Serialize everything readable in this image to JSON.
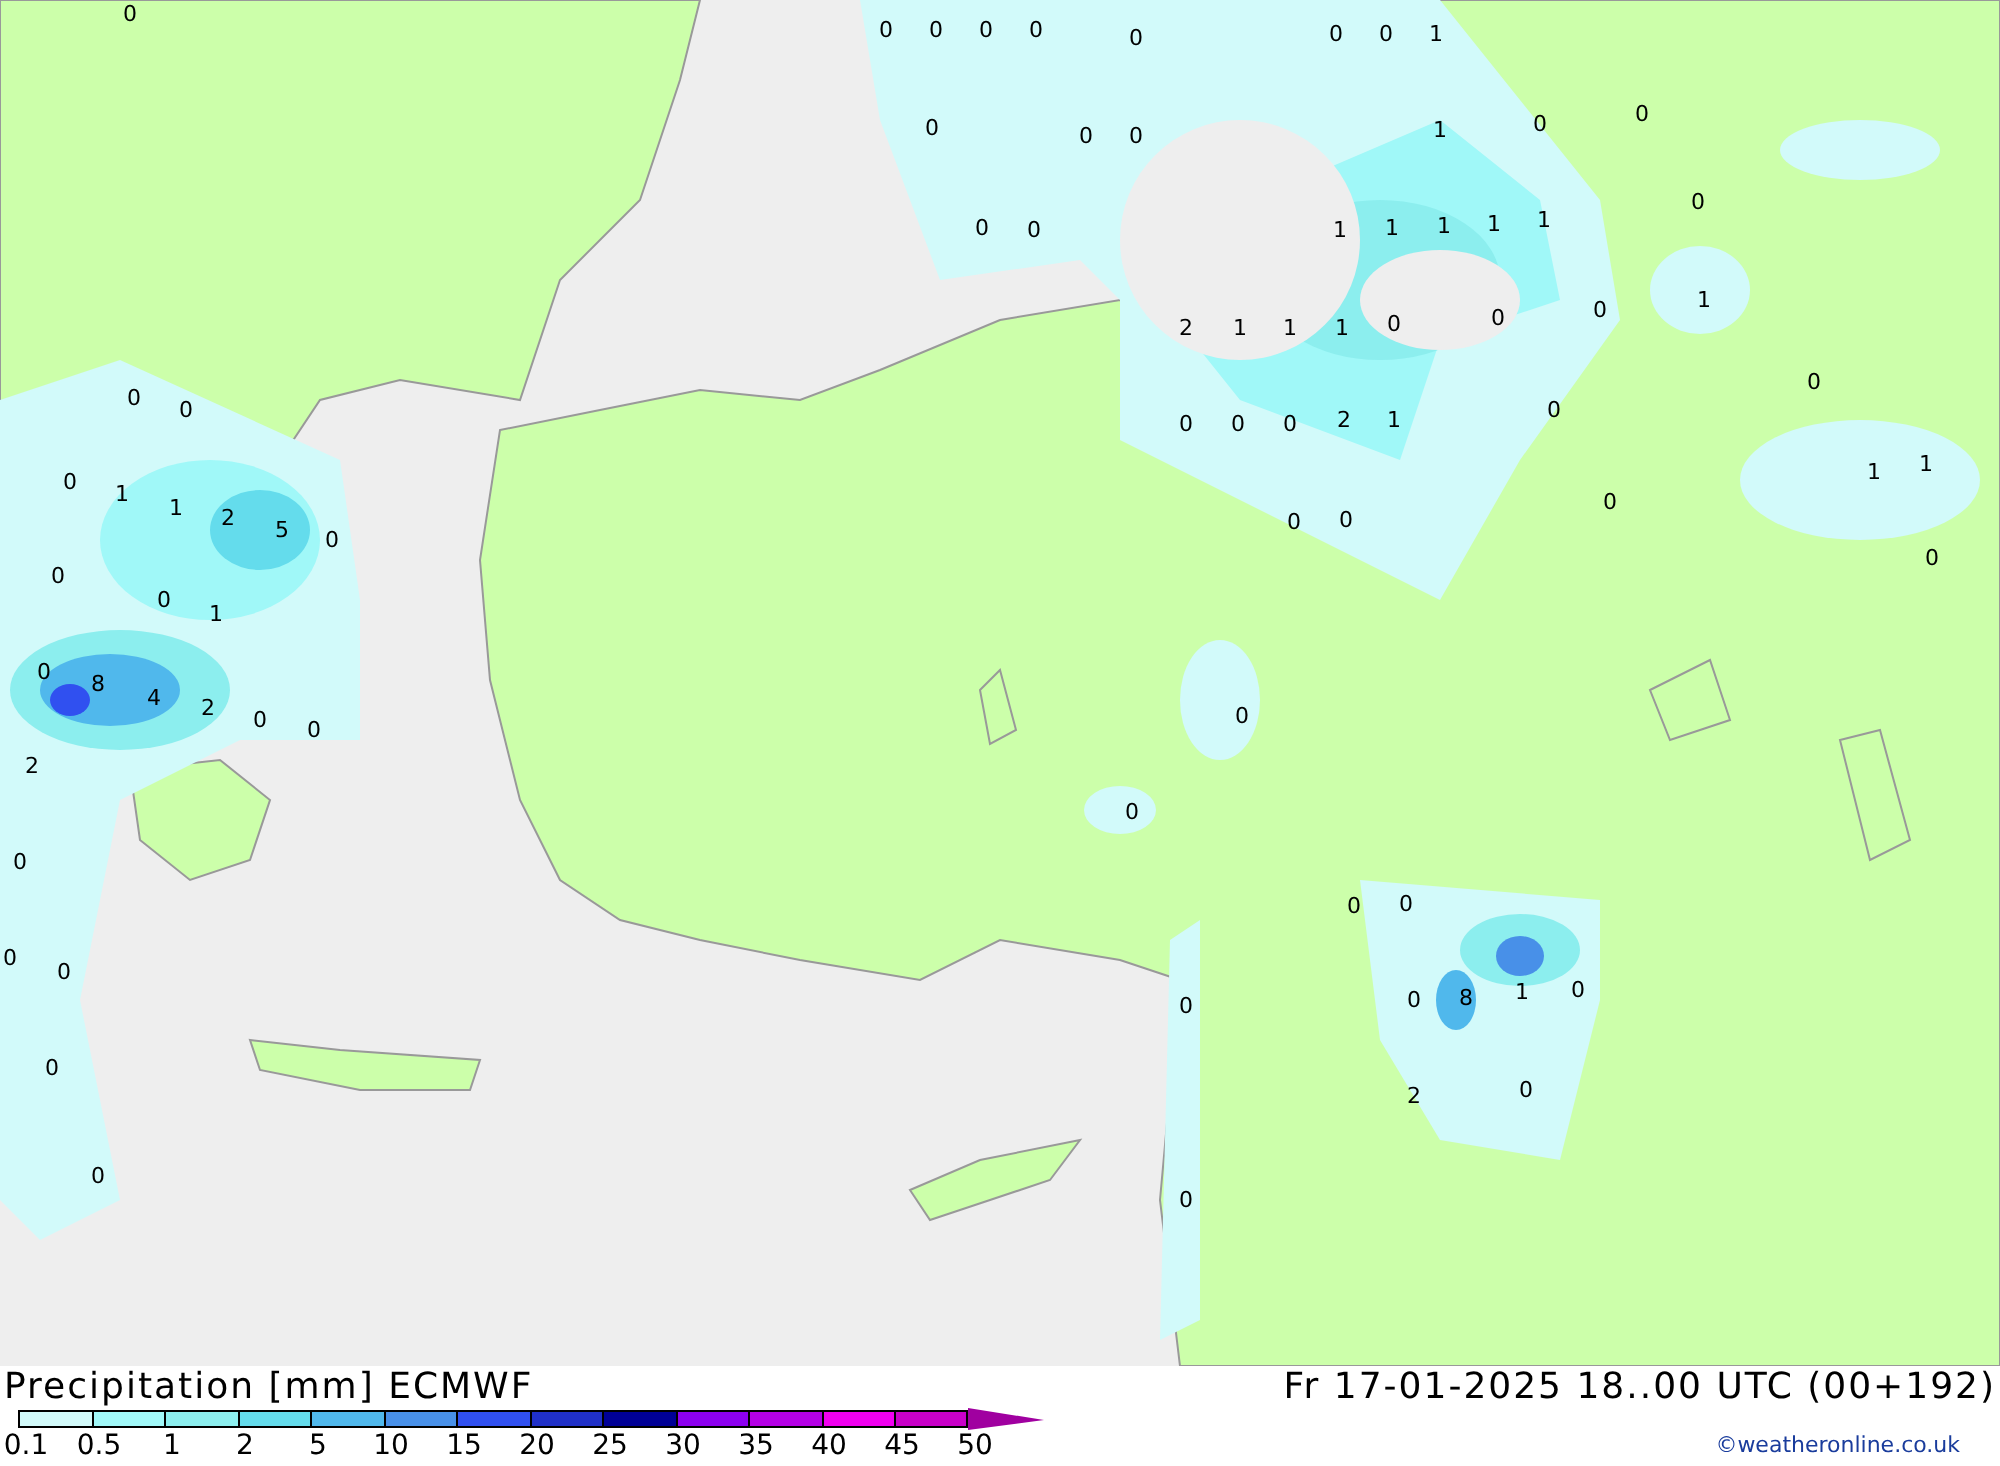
{
  "map": {
    "values": [
      "0",
      "0",
      "0",
      "0",
      "0",
      "0",
      "0",
      "0",
      "1",
      "0",
      "0",
      "0",
      "1",
      "0",
      "0",
      "0",
      "0",
      "0",
      "1",
      "1",
      "1",
      "1",
      "1",
      "2",
      "1",
      "1",
      "1",
      "0",
      "0",
      "0",
      "1",
      "0",
      "0",
      "0",
      "2",
      "1",
      "0",
      "0",
      "1",
      "1",
      "0",
      "0",
      "0",
      "0",
      "0",
      "0",
      "0",
      "1",
      "1",
      "2",
      "5",
      "0",
      "0",
      "0",
      "1",
      "0",
      "8",
      "4",
      "2",
      "0",
      "0",
      "2",
      "0",
      "0",
      "0",
      "0",
      "0",
      "0",
      "0",
      "0",
      "0",
      "0",
      "8",
      "1",
      "0",
      "0",
      "2",
      "0",
      "0"
    ]
  },
  "footer": {
    "title": "Precipitation [mm] ECMWF",
    "datetime": "Fr 17-01-2025 18..00 UTC (00+192)",
    "credit": "©weatheronline.co.uk"
  },
  "legend": {
    "ticks": [
      "0.1",
      "0.5",
      "1",
      "2",
      "5",
      "10",
      "15",
      "20",
      "25",
      "30",
      "35",
      "40",
      "45",
      "50"
    ],
    "bins": [
      {
        "color": "#d2fafa"
      },
      {
        "color": "#a0f8f8"
      },
      {
        "color": "#8ceeee"
      },
      {
        "color": "#64dcec"
      },
      {
        "color": "#50b8ec"
      },
      {
        "color": "#4890e8"
      },
      {
        "color": "#3050f0"
      },
      {
        "color": "#2030c8"
      },
      {
        "color": "#000096"
      },
      {
        "color": "#8c00f0"
      },
      {
        "color": "#b400e6"
      },
      {
        "color": "#f000f0"
      },
      {
        "color": "#c800c8"
      }
    ],
    "overflow": {
      "color": "#a000a0"
    }
  }
}
